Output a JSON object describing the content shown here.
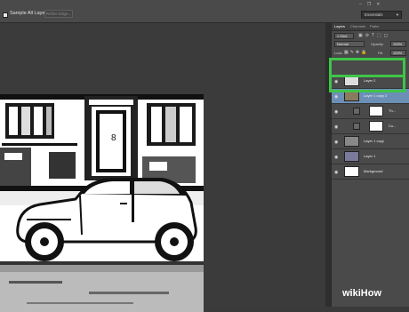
{
  "options_bar": {
    "sample_all_layers": "Sample All Layers",
    "refine_edge": "Refine Edge...",
    "workspace": "Essentials"
  },
  "panel": {
    "tabs": [
      "Layers",
      "Channels",
      "Paths"
    ],
    "kind_label": "Kind",
    "blend_mode": "Normal",
    "opacity_label": "Opacity:",
    "opacity_value": "100%",
    "lock_label": "Lock:",
    "fill_label": "Fill:",
    "fill_value": "100%"
  },
  "layers": [
    {
      "name": "Layer 2",
      "selected": false,
      "kind": "pixel"
    },
    {
      "name": "Layer 1 copy 2",
      "selected": true,
      "kind": "pixel"
    },
    {
      "name": "Th...",
      "selected": false,
      "kind": "adjustment"
    },
    {
      "name": "Cu...",
      "selected": false,
      "kind": "adjustment"
    },
    {
      "name": "Layer 1 copy",
      "selected": false,
      "kind": "pixel"
    },
    {
      "name": "Layer 1",
      "selected": false,
      "kind": "pixel"
    },
    {
      "name": "Background",
      "selected": false,
      "kind": "background"
    }
  ],
  "watermark": {
    "brand": "wiki",
    "suffix": "How"
  },
  "colors": {
    "selection": "#6b8fb5",
    "highlight": "#3fc548"
  }
}
